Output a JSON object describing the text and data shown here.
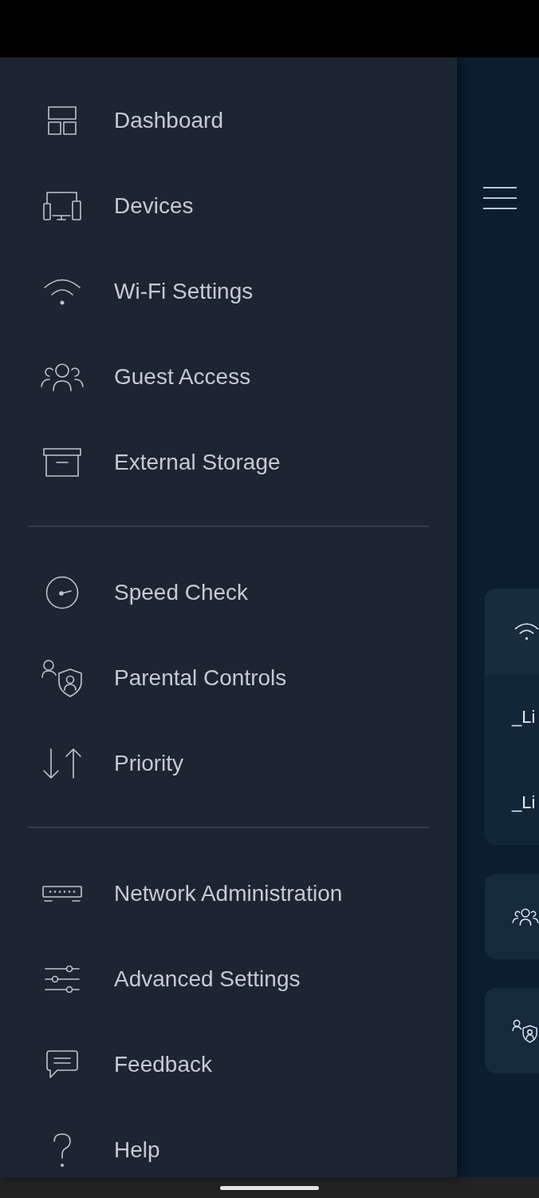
{
  "menu": {
    "groups": [
      {
        "items": [
          {
            "kind": "dashboard",
            "label": "Dashboard"
          },
          {
            "kind": "devices",
            "label": "Devices"
          },
          {
            "kind": "wifi",
            "label": "Wi-Fi Settings"
          },
          {
            "kind": "guests",
            "label": "Guest Access"
          },
          {
            "kind": "storage",
            "label": "External Storage"
          }
        ]
      },
      {
        "items": [
          {
            "kind": "speed",
            "label": "Speed Check"
          },
          {
            "kind": "parental",
            "label": "Parental Controls"
          },
          {
            "kind": "priority",
            "label": "Priority"
          }
        ]
      },
      {
        "items": [
          {
            "kind": "network",
            "label": "Network Administration"
          },
          {
            "kind": "sliders",
            "label": "Advanced Settings"
          },
          {
            "kind": "feedback",
            "label": "Feedback"
          },
          {
            "kind": "help",
            "label": "Help"
          }
        ]
      }
    ]
  },
  "dashboard": {
    "cards": [
      {
        "rows": [
          {
            "kind": "wifi"
          },
          {
            "kind": "text",
            "text": "_Li"
          },
          {
            "kind": "text",
            "text": "_Li"
          }
        ]
      },
      {
        "rows": [
          {
            "kind": "guests"
          }
        ]
      },
      {
        "rows": [
          {
            "kind": "parental"
          }
        ]
      }
    ]
  }
}
